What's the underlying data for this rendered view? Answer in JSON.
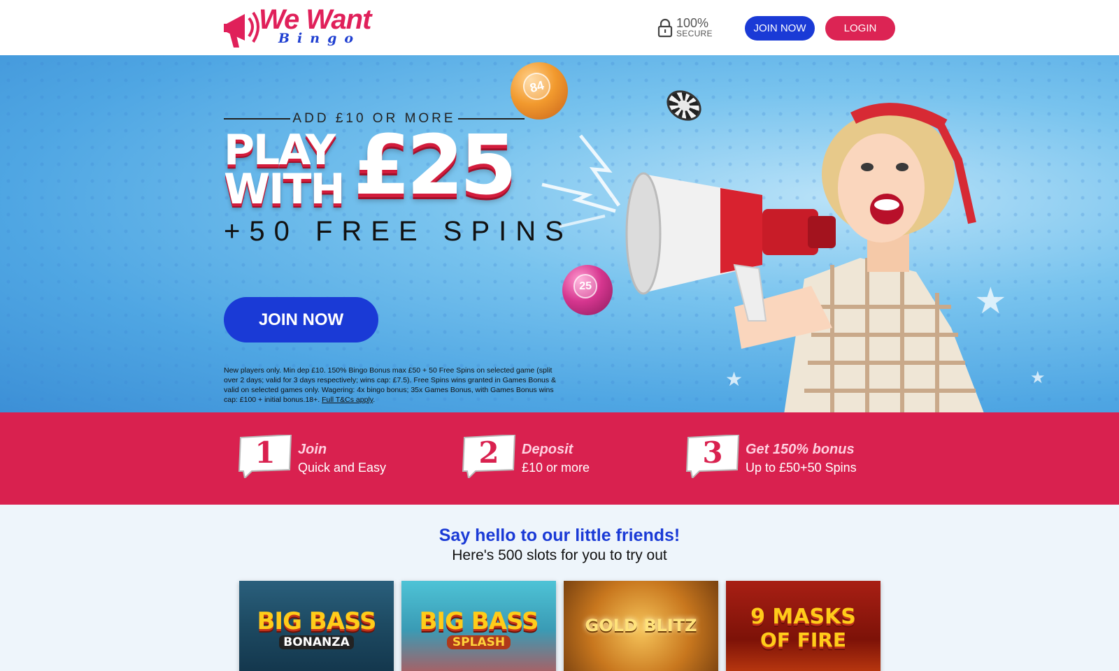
{
  "brand": {
    "name_line1": "We Want",
    "name_line2": "Bingo"
  },
  "header": {
    "secure_pct": "100%",
    "secure_label": "SECURE",
    "join_label": "JOIN NOW",
    "login_label": "LOGIN"
  },
  "colors": {
    "blue": "#1a3ad6",
    "pink": "#dc2454",
    "band": "#d9214f"
  },
  "hero": {
    "pre_text": "ADD £10 OR MORE",
    "headline_words": "PLAY WITH",
    "headline_amount": "£25",
    "sub_text": "+50 FREE SPINS",
    "join_label": "JOIN NOW",
    "terms": "New players only. Min dep £10. 150% Bingo Bonus max £50 + 50 Free Spins on selected game (split over 2 days; valid for 3 days respectively; wins cap: £7.5). Free Spins wins granted in Games Bonus & valid on selected games only. Wagering: 4x bingo bonus; 35x Games Bonus, with Games Bonus wins cap: £100 + initial bonus.18+.",
    "terms_link": "Full T&Cs apply",
    "terms_end": ".",
    "ball_1": "84",
    "ball_2": "25"
  },
  "steps": [
    {
      "num": "1",
      "title": "Join",
      "desc": "Quick and Easy"
    },
    {
      "num": "2",
      "title": "Deposit",
      "desc": "£10 or more"
    },
    {
      "num": "3",
      "title": "Get 150% bonus",
      "desc": "Up to £50+50 Spins"
    }
  ],
  "slots": {
    "title": "Say hello to our little friends!",
    "subtitle": "Here's 500 slots for you to try out",
    "games": [
      {
        "line1": "BIG BASS",
        "line2": "BONANZA"
      },
      {
        "line1": "BIG BASS",
        "line2": "SPLASH"
      },
      {
        "line1": "GOLD BLITZ",
        "line2": ""
      },
      {
        "line1": "9 MASKS",
        "line2": "OF FIRE"
      }
    ]
  }
}
